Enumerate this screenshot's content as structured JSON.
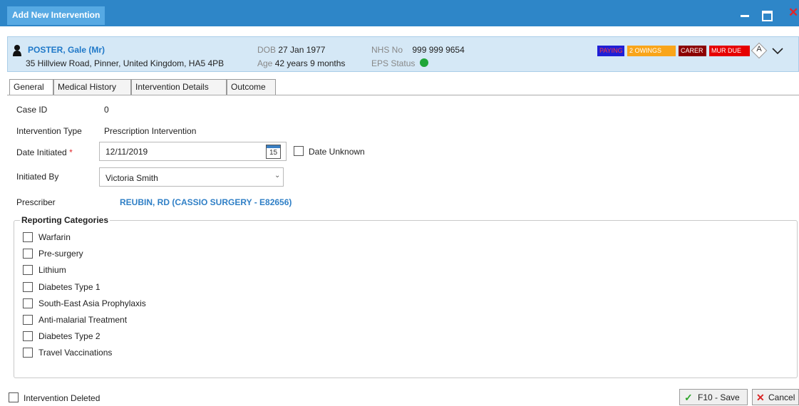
{
  "window": {
    "title": "Add New Intervention",
    "close_glyph": "✕",
    "accent_color": "#2e86c8"
  },
  "patient": {
    "name": "POSTER, Gale (Mr)",
    "address": "35 Hillview Road, Pinner, United Kingdom, HA5 4PB",
    "dob_label": "DOB",
    "dob": "27 Jan 1977",
    "age_label": "Age",
    "age": "42 years 9 months",
    "nhs_label": "NHS No",
    "nhs_no": "999 999 9654",
    "eps_label": "EPS Status",
    "eps_status_color": "#1fa638",
    "badges": [
      "PAYING",
      "2 OWINGS",
      "CARER",
      "MUR DUE"
    ],
    "diamond_letter": "A"
  },
  "tabs": [
    "General",
    "Medical History",
    "Intervention Details",
    "Outcome"
  ],
  "form": {
    "case_id_label": "Case ID",
    "case_id": "0",
    "intervention_type_label": "Intervention Type",
    "intervention_type": "Prescription Intervention",
    "date_initiated_label": "Date Initiated",
    "required_mark": "*",
    "date_initiated": "12/11/2019",
    "calendar_day": "15",
    "date_unknown_label": "Date Unknown",
    "initiated_by_label": "Initiated By",
    "initiated_by": "Victoria Smith",
    "prescriber_label": "Prescriber",
    "prescriber": "REUBIN, RD (CASSIO SURGERY - E82656)"
  },
  "reporting": {
    "title": "Reporting Categories",
    "categories": [
      "Warfarin",
      "Pre-surgery",
      "Lithium",
      "Diabetes Type 1",
      "South-East Asia Prophylaxis",
      "Anti-malarial Treatment",
      "Diabetes Type 2",
      "Travel Vaccinations"
    ]
  },
  "footer": {
    "deleted_label": "Intervention Deleted",
    "save_label": "F10 - Save",
    "cancel_label": "Cancel"
  }
}
